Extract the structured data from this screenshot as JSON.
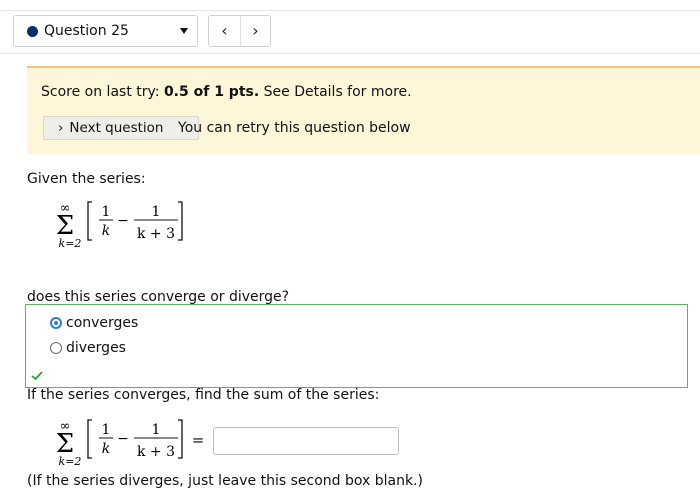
{
  "header": {
    "question_label": "Question 25",
    "prev_label": "‹",
    "next_label": "›"
  },
  "score": {
    "prefix": "Score on last try: ",
    "value": "0.5 of 1 pts.",
    "suffix": " See Details for more.",
    "next_button_label": "Next question",
    "retry_text": "You can retry this question below"
  },
  "problem": {
    "given_text": "Given the series:",
    "series": {
      "upper_limit": "∞",
      "lower_limit": "k=2",
      "term1_num": "1",
      "term1_den": "k",
      "minus": "−",
      "term2_num": "1",
      "term2_den": "k + 3"
    },
    "question_text": "does this series converge or diverge?",
    "options": [
      {
        "label": "converges",
        "selected": true
      },
      {
        "label": "diverges",
        "selected": false
      }
    ],
    "result": "correct",
    "sum_prompt": "If the series converges, find the sum of the series:",
    "equals": "=",
    "answer_value": "",
    "note": "(If the series diverges, just leave this second box blank.)"
  },
  "colors": {
    "score_bg": "#fdf6d8",
    "score_border": "#f2c77b",
    "correct_border": "#5fb25f",
    "radio_selected": "#2d7fd6"
  }
}
